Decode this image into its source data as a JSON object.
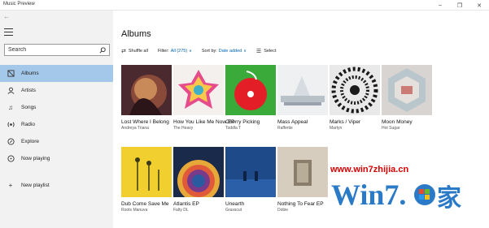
{
  "window": {
    "title": "Music Preview",
    "buttons": [
      "–",
      "❐",
      "✕"
    ]
  },
  "sidebar": {
    "back_icon": "back-arrow-icon",
    "search_placeholder": "Search",
    "items": [
      {
        "label": "Albums",
        "icon": "album-icon",
        "active": true
      },
      {
        "label": "Artists",
        "icon": "artist-icon",
        "active": false
      },
      {
        "label": "Songs",
        "icon": "note-icon",
        "active": false
      },
      {
        "label": "Radio",
        "icon": "radio-icon",
        "active": false
      },
      {
        "label": "Explore",
        "icon": "explore-icon",
        "active": false
      },
      {
        "label": "Now playing",
        "icon": "now-playing-icon",
        "active": false
      },
      {
        "label": "New playlist",
        "icon": "plus-icon",
        "active": false
      }
    ],
    "accent": "#a4c8ea"
  },
  "main": {
    "title": "Albums",
    "toolbar": {
      "shuffle": "Shuffle all",
      "filter_label": "Filter:",
      "filter_value": "All (275)",
      "sort_label": "Sort by:",
      "sort_value": "Date added",
      "select": "Select"
    },
    "albums": [
      {
        "title": "Lost Where I Belong",
        "artist": "Andreya Triana"
      },
      {
        "title": "How You Like Me Now EP",
        "artist": "The Heavy"
      },
      {
        "title": "Cherry Picking",
        "artist": "Toddla T"
      },
      {
        "title": "Mass Appeal",
        "artist": "Raffertie"
      },
      {
        "title": "Marks / Viper",
        "artist": "Martyn"
      },
      {
        "title": "Moon Money",
        "artist": "Hot Sugar"
      },
      {
        "title": "Dub Come Save Me",
        "artist": "Roots Manuva"
      },
      {
        "title": "Atlantis EP",
        "artist": "Falty DL"
      },
      {
        "title": "Unearth",
        "artist": "Grasscut"
      },
      {
        "title": "Nothing To Fear EP",
        "artist": "Dobie"
      }
    ],
    "link_color": "#0063b1"
  },
  "watermark": {
    "url": "www.win7zhijia.cn"
  }
}
